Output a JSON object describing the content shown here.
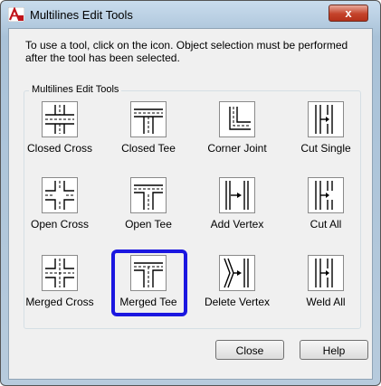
{
  "window": {
    "title": "Multilines Edit Tools",
    "close_glyph": "x"
  },
  "app_icon": {
    "name": "autocad-app-icon"
  },
  "instructions": "To use a tool, click on the icon.  Object selection must be performed after the tool has been selected.",
  "group": {
    "label": "Multilines Edit Tools"
  },
  "tools": [
    {
      "label": "Closed Cross"
    },
    {
      "label": "Closed Tee"
    },
    {
      "label": "Corner Joint"
    },
    {
      "label": "Cut Single"
    },
    {
      "label": "Open Cross"
    },
    {
      "label": "Open Tee"
    },
    {
      "label": "Add Vertex"
    },
    {
      "label": "Cut All"
    },
    {
      "label": "Merged Cross"
    },
    {
      "label": "Merged Tee"
    },
    {
      "label": "Delete Vertex"
    },
    {
      "label": "Weld All"
    }
  ],
  "highlight_color": "#1b17e0",
  "buttons": {
    "close": "Close",
    "help": "Help"
  }
}
